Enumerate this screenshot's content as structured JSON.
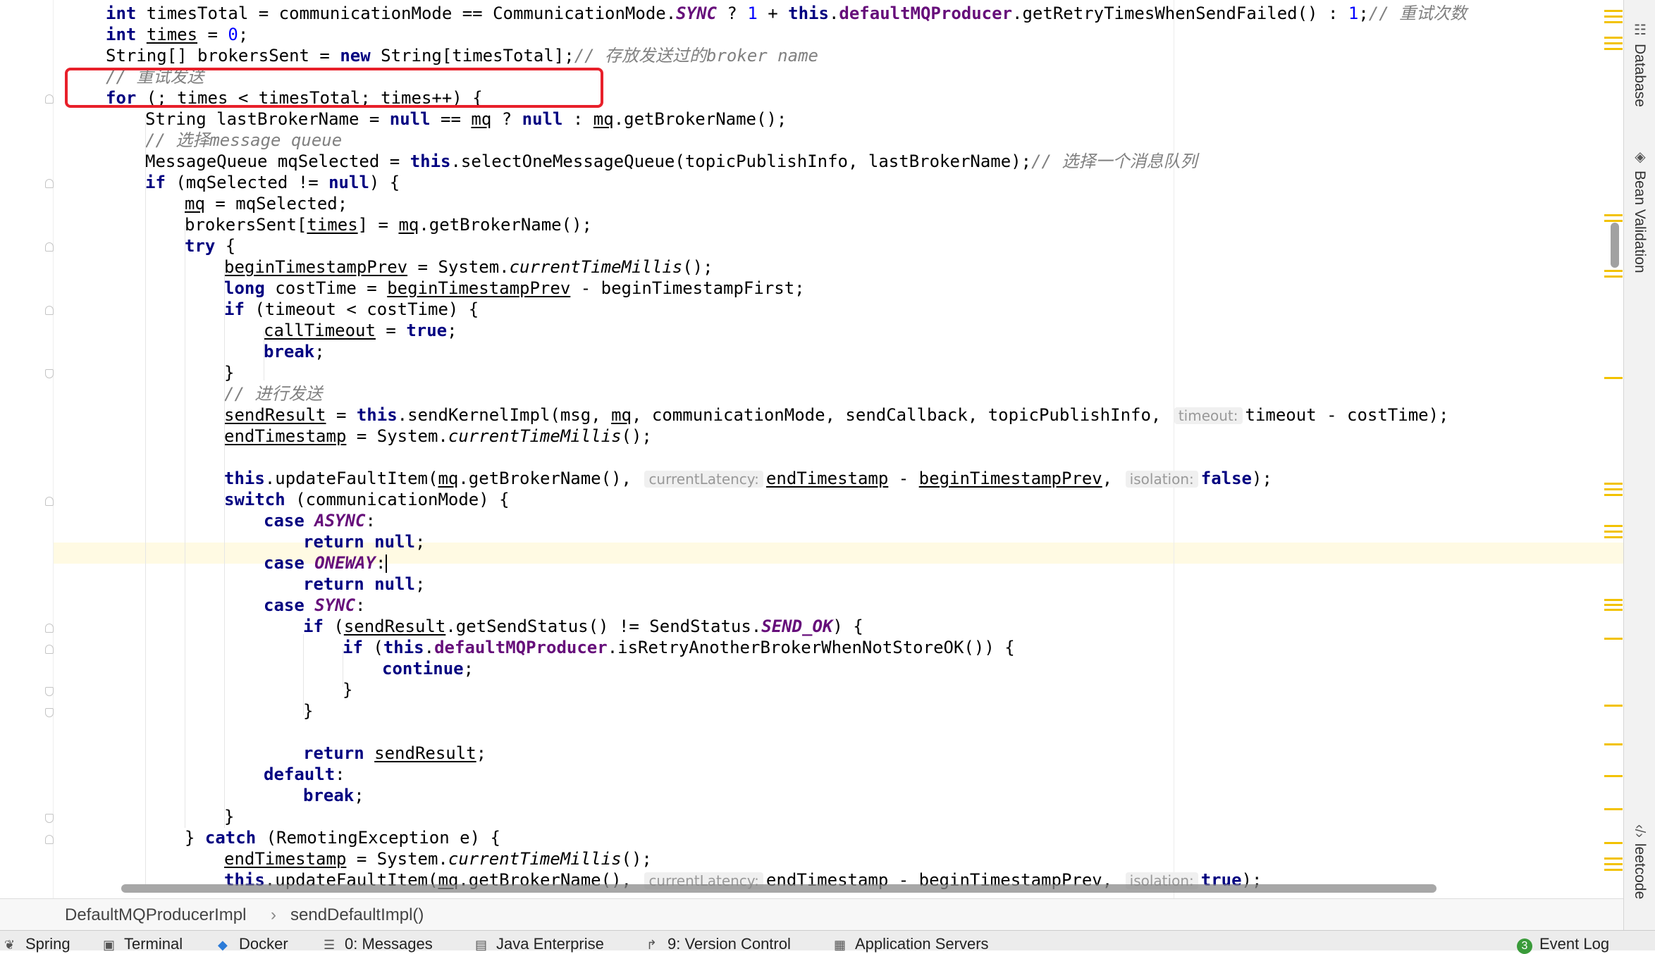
{
  "code_lines": [
    {
      "indent": 0,
      "tokens": [
        {
          "t": "int",
          "c": "kw"
        },
        {
          "t": " timesTotal = communicationMode == CommunicationMode."
        },
        {
          "t": "SYNC",
          "c": "cst"
        },
        {
          "t": " ? "
        },
        {
          "t": "1",
          "c": "num"
        },
        {
          "t": " + "
        },
        {
          "t": "this",
          "c": "kw"
        },
        {
          "t": "."
        },
        {
          "t": "defaultMQProducer",
          "c": "fld"
        },
        {
          "t": ".getRetryTimesWhenSendFailed() : "
        },
        {
          "t": "1",
          "c": "num"
        },
        {
          "t": ";"
        },
        {
          "t": "// 重试次数",
          "c": "com"
        }
      ]
    },
    {
      "indent": 0,
      "tokens": [
        {
          "t": "int",
          "c": "kw"
        },
        {
          "t": " "
        },
        {
          "t": "times",
          "c": "u"
        },
        {
          "t": " = "
        },
        {
          "t": "0",
          "c": "num"
        },
        {
          "t": ";"
        }
      ]
    },
    {
      "indent": 0,
      "tokens": [
        {
          "t": "String[] brokersSent = "
        },
        {
          "t": "new",
          "c": "kw"
        },
        {
          "t": " String[timesTotal];"
        },
        {
          "t": "// 存放发送过的broker name",
          "c": "com"
        }
      ]
    },
    {
      "indent": 0,
      "tokens": [
        {
          "t": "// 重试发送",
          "c": "com"
        }
      ]
    },
    {
      "indent": 0,
      "tokens": [
        {
          "t": "for",
          "c": "kw"
        },
        {
          "t": " (; "
        },
        {
          "t": "times",
          "c": "u"
        },
        {
          "t": " < timesTotal; "
        },
        {
          "t": "times",
          "c": "u"
        },
        {
          "t": "++) {"
        }
      ]
    },
    {
      "indent": 1,
      "tokens": [
        {
          "t": "String lastBrokerName = "
        },
        {
          "t": "null",
          "c": "kw"
        },
        {
          "t": " == "
        },
        {
          "t": "mq",
          "c": "u"
        },
        {
          "t": " ? "
        },
        {
          "t": "null",
          "c": "kw"
        },
        {
          "t": " : "
        },
        {
          "t": "mq",
          "c": "u"
        },
        {
          "t": ".getBrokerName();"
        }
      ]
    },
    {
      "indent": 1,
      "tokens": [
        {
          "t": "// 选择message queue",
          "c": "com"
        }
      ]
    },
    {
      "indent": 1,
      "tokens": [
        {
          "t": "MessageQueue mqSelected = "
        },
        {
          "t": "this",
          "c": "kw"
        },
        {
          "t": ".selectOneMessageQueue(topicPublishInfo, lastBrokerName);"
        },
        {
          "t": "// 选择一个消息队列",
          "c": "com"
        }
      ]
    },
    {
      "indent": 1,
      "tokens": [
        {
          "t": "if",
          "c": "kw"
        },
        {
          "t": " (mqSelected != "
        },
        {
          "t": "null",
          "c": "kw"
        },
        {
          "t": ") {"
        }
      ]
    },
    {
      "indent": 2,
      "tokens": [
        {
          "t": "mq",
          "c": "u"
        },
        {
          "t": " = mqSelected;"
        }
      ]
    },
    {
      "indent": 2,
      "tokens": [
        {
          "t": "brokersSent["
        },
        {
          "t": "times",
          "c": "u"
        },
        {
          "t": "] = "
        },
        {
          "t": "mq",
          "c": "u"
        },
        {
          "t": ".getBrokerName();"
        }
      ]
    },
    {
      "indent": 2,
      "tokens": [
        {
          "t": "try",
          "c": "kw"
        },
        {
          "t": " {"
        }
      ]
    },
    {
      "indent": 3,
      "tokens": [
        {
          "t": "beginTimestampPrev",
          "c": "u"
        },
        {
          "t": " = System."
        },
        {
          "t": "currentTimeMillis",
          "c": "sta"
        },
        {
          "t": "();"
        }
      ]
    },
    {
      "indent": 3,
      "tokens": [
        {
          "t": "long",
          "c": "kw"
        },
        {
          "t": " costTime = "
        },
        {
          "t": "beginTimestampPrev",
          "c": "u"
        },
        {
          "t": " - beginTimestampFirst;"
        }
      ]
    },
    {
      "indent": 3,
      "tokens": [
        {
          "t": "if",
          "c": "kw"
        },
        {
          "t": " (timeout < costTime) {"
        }
      ]
    },
    {
      "indent": 4,
      "tokens": [
        {
          "t": "callTimeout",
          "c": "u"
        },
        {
          "t": " = "
        },
        {
          "t": "true",
          "c": "kw"
        },
        {
          "t": ";"
        }
      ]
    },
    {
      "indent": 4,
      "tokens": [
        {
          "t": "break",
          "c": "kw"
        },
        {
          "t": ";"
        }
      ]
    },
    {
      "indent": 3,
      "tokens": [
        {
          "t": "}"
        }
      ]
    },
    {
      "indent": 3,
      "tokens": [
        {
          "t": "// 进行发送",
          "c": "com"
        }
      ]
    },
    {
      "indent": 3,
      "tokens": [
        {
          "t": "sendResult",
          "c": "u"
        },
        {
          "t": " = "
        },
        {
          "t": "this",
          "c": "kw"
        },
        {
          "t": ".sendKernelImpl(msg, "
        },
        {
          "t": "mq",
          "c": "u"
        },
        {
          "t": ", communicationMode, sendCallback, topicPublishInfo, "
        },
        {
          "t": "timeout:",
          "c": "hint"
        },
        {
          "t": "timeout - costTime);"
        }
      ]
    },
    {
      "indent": 3,
      "tokens": [
        {
          "t": "endTimestamp",
          "c": "u"
        },
        {
          "t": " = System."
        },
        {
          "t": "currentTimeMillis",
          "c": "sta"
        },
        {
          "t": "();"
        }
      ]
    },
    {
      "indent": 3,
      "tokens": []
    },
    {
      "indent": 3,
      "tokens": [
        {
          "t": "this",
          "c": "kw"
        },
        {
          "t": ".updateFaultItem("
        },
        {
          "t": "mq",
          "c": "u"
        },
        {
          "t": ".getBrokerName(), "
        },
        {
          "t": "currentLatency:",
          "c": "hint"
        },
        {
          "t": "endTimestamp",
          "c": "u"
        },
        {
          "t": " - "
        },
        {
          "t": "beginTimestampPrev",
          "c": "u"
        },
        {
          "t": ", "
        },
        {
          "t": "isolation:",
          "c": "hint"
        },
        {
          "t": "false",
          "c": "kw"
        },
        {
          "t": ");"
        }
      ]
    },
    {
      "indent": 3,
      "tokens": [
        {
          "t": "switch",
          "c": "kw"
        },
        {
          "t": " (communicationMode) {"
        }
      ]
    },
    {
      "indent": 4,
      "tokens": [
        {
          "t": "case",
          "c": "kw"
        },
        {
          "t": " "
        },
        {
          "t": "ASYNC",
          "c": "cst"
        },
        {
          "t": ":"
        }
      ]
    },
    {
      "indent": 5,
      "tokens": [
        {
          "t": "return",
          "c": "kw"
        },
        {
          "t": " "
        },
        {
          "t": "null",
          "c": "kw"
        },
        {
          "t": ";"
        }
      ]
    },
    {
      "indent": 4,
      "caret": true,
      "tokens": [
        {
          "t": "case",
          "c": "kw"
        },
        {
          "t": " "
        },
        {
          "t": "ONEWAY",
          "c": "cst"
        },
        {
          "t": ":"
        }
      ]
    },
    {
      "indent": 5,
      "tokens": [
        {
          "t": "return",
          "c": "kw"
        },
        {
          "t": " "
        },
        {
          "t": "null",
          "c": "kw"
        },
        {
          "t": ";"
        }
      ]
    },
    {
      "indent": 4,
      "tokens": [
        {
          "t": "case",
          "c": "kw"
        },
        {
          "t": " "
        },
        {
          "t": "SYNC",
          "c": "cst"
        },
        {
          "t": ":"
        }
      ]
    },
    {
      "indent": 5,
      "tokens": [
        {
          "t": "if",
          "c": "kw"
        },
        {
          "t": " ("
        },
        {
          "t": "sendResult",
          "c": "u"
        },
        {
          "t": ".getSendStatus() != SendStatus."
        },
        {
          "t": "SEND_OK",
          "c": "cst"
        },
        {
          "t": ") {"
        }
      ]
    },
    {
      "indent": 6,
      "tokens": [
        {
          "t": "if",
          "c": "kw"
        },
        {
          "t": " ("
        },
        {
          "t": "this",
          "c": "kw"
        },
        {
          "t": "."
        },
        {
          "t": "defaultMQProducer",
          "c": "fld"
        },
        {
          "t": ".isRetryAnotherBrokerWhenNotStoreOK()) {"
        }
      ]
    },
    {
      "indent": 7,
      "tokens": [
        {
          "t": "continue",
          "c": "kw"
        },
        {
          "t": ";"
        }
      ]
    },
    {
      "indent": 6,
      "tokens": [
        {
          "t": "}"
        }
      ]
    },
    {
      "indent": 5,
      "tokens": [
        {
          "t": "}"
        }
      ]
    },
    {
      "indent": 5,
      "tokens": []
    },
    {
      "indent": 5,
      "tokens": [
        {
          "t": "return",
          "c": "kw"
        },
        {
          "t": " "
        },
        {
          "t": "sendResult",
          "c": "u"
        },
        {
          "t": ";"
        }
      ]
    },
    {
      "indent": 4,
      "tokens": [
        {
          "t": "default",
          "c": "kw"
        },
        {
          "t": ":"
        }
      ]
    },
    {
      "indent": 5,
      "tokens": [
        {
          "t": "break",
          "c": "kw"
        },
        {
          "t": ";"
        }
      ]
    },
    {
      "indent": 3,
      "tokens": [
        {
          "t": "}"
        }
      ]
    },
    {
      "indent": 2,
      "tokens": [
        {
          "t": "} "
        },
        {
          "t": "catch",
          "c": "kw"
        },
        {
          "t": " (RemotingException e) {"
        }
      ]
    },
    {
      "indent": 3,
      "tokens": [
        {
          "t": "endTimestamp",
          "c": "u"
        },
        {
          "t": " = System."
        },
        {
          "t": "currentTimeMillis",
          "c": "sta"
        },
        {
          "t": "();"
        }
      ]
    },
    {
      "indent": 3,
      "tokens": [
        {
          "t": "this",
          "c": "kw"
        },
        {
          "t": ".updateFaultItem("
        },
        {
          "t": "mq",
          "c": "u"
        },
        {
          "t": ".getBrokerName(), "
        },
        {
          "t": "currentLatency:",
          "c": "hint"
        },
        {
          "t": "endTimestamp - beginTimestampPrev, "
        },
        {
          "t": "isolation:",
          "c": "hint"
        },
        {
          "t": "true",
          "c": "kw"
        },
        {
          "t": ");"
        }
      ]
    }
  ],
  "breadcrumbs": [
    "DefaultMQProducerImpl",
    "sendDefaultImpl()"
  ],
  "breadcrumb_separator": "›",
  "right_tool_tabs": [
    {
      "label": "Database",
      "icon": "database-icon"
    },
    {
      "label": "Bean Validation",
      "icon": "bean-validation-icon"
    },
    {
      "label": "leetcode",
      "icon": "leetcode-icon"
    }
  ],
  "bottom_tool_tabs": [
    {
      "label": "Spring",
      "icon": "spring-icon"
    },
    {
      "label": "Terminal",
      "icon": "terminal-icon"
    },
    {
      "label": "Docker",
      "icon": "docker-icon"
    },
    {
      "label": "0: Messages",
      "icon": "messages-icon"
    },
    {
      "label": "Java Enterprise",
      "icon": "java-enterprise-icon"
    },
    {
      "label": "9: Version Control",
      "icon": "version-control-icon"
    },
    {
      "label": "Application Servers",
      "icon": "application-servers-icon"
    }
  ],
  "event_log": {
    "label": "Event Log",
    "count": "3",
    "icon": "event-log-icon"
  },
  "colors": {
    "keyword": "#000080",
    "field": "#660e7a",
    "number": "#0000ff",
    "comment": "#808080",
    "highlight_box": "#e8202a",
    "current_line": "#fffae3",
    "stripe_marker": "#f2c200"
  }
}
